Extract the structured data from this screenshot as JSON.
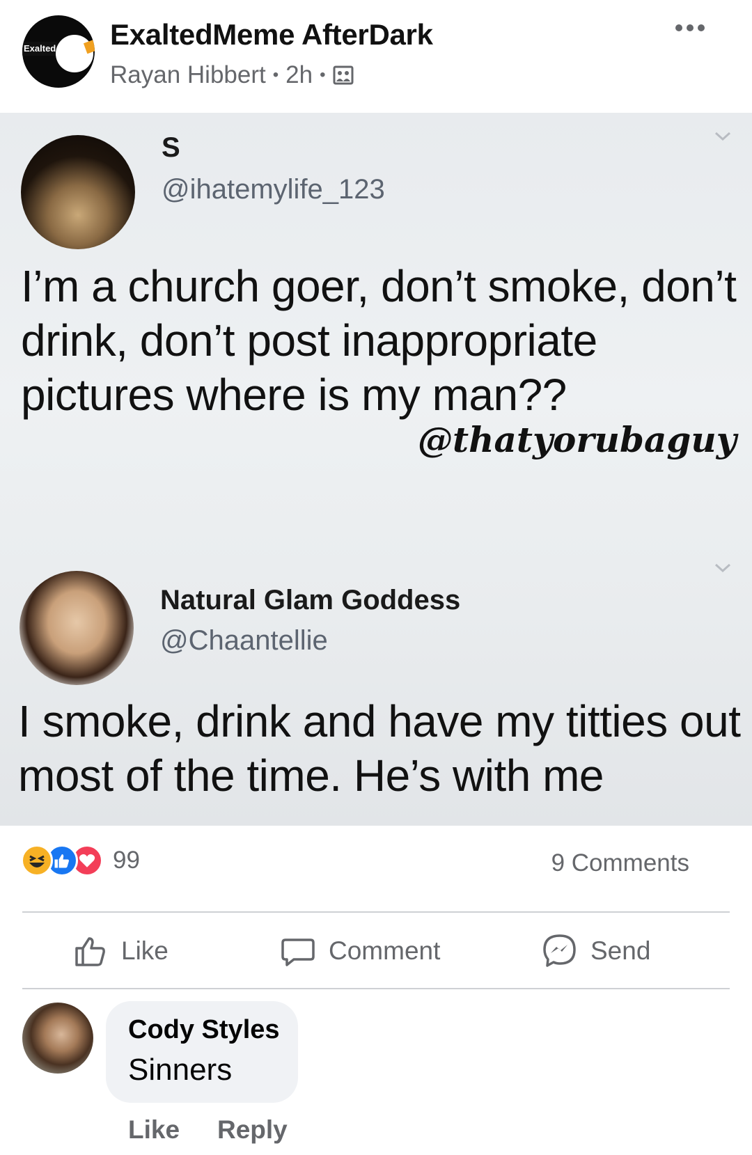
{
  "post": {
    "group_name": "ExaltedMeme AfterDark",
    "author": "Rayan Hibbert",
    "separator": "•",
    "time": "2h",
    "audience_icon": "group-photo-icon",
    "group_logo_text": "Exalted",
    "more_icon": "more-dots-icon"
  },
  "image": {
    "tweet1": {
      "name": "S",
      "handle": "@ihatemylife_123",
      "text": "I’m a church goer, don’t smoke, don’t drink, don’t post inappropriate pictures where is my man??"
    },
    "watermark": "@thatyorubaguy",
    "tweet2": {
      "name": "Natural Glam Goddess",
      "handle": "@Chaantellie",
      "text": "I smoke, drink and have my titties out most of the time. He’s with me"
    }
  },
  "stats": {
    "reaction_count": "99",
    "reaction_icons": [
      "haha-icon",
      "like-icon",
      "love-icon"
    ],
    "comments": "9 Comments"
  },
  "actions": {
    "like": "Like",
    "comment": "Comment",
    "send": "Send"
  },
  "comment": {
    "author": "Cody Styles",
    "text": "Sinners",
    "like": "Like",
    "reply": "Reply"
  },
  "colors": {
    "secondary_text": "#65676b",
    "like_blue": "#1877f2",
    "love_red": "#f33e58",
    "haha_yellow": "#f7b125",
    "bubble_bg": "#f0f2f5"
  }
}
